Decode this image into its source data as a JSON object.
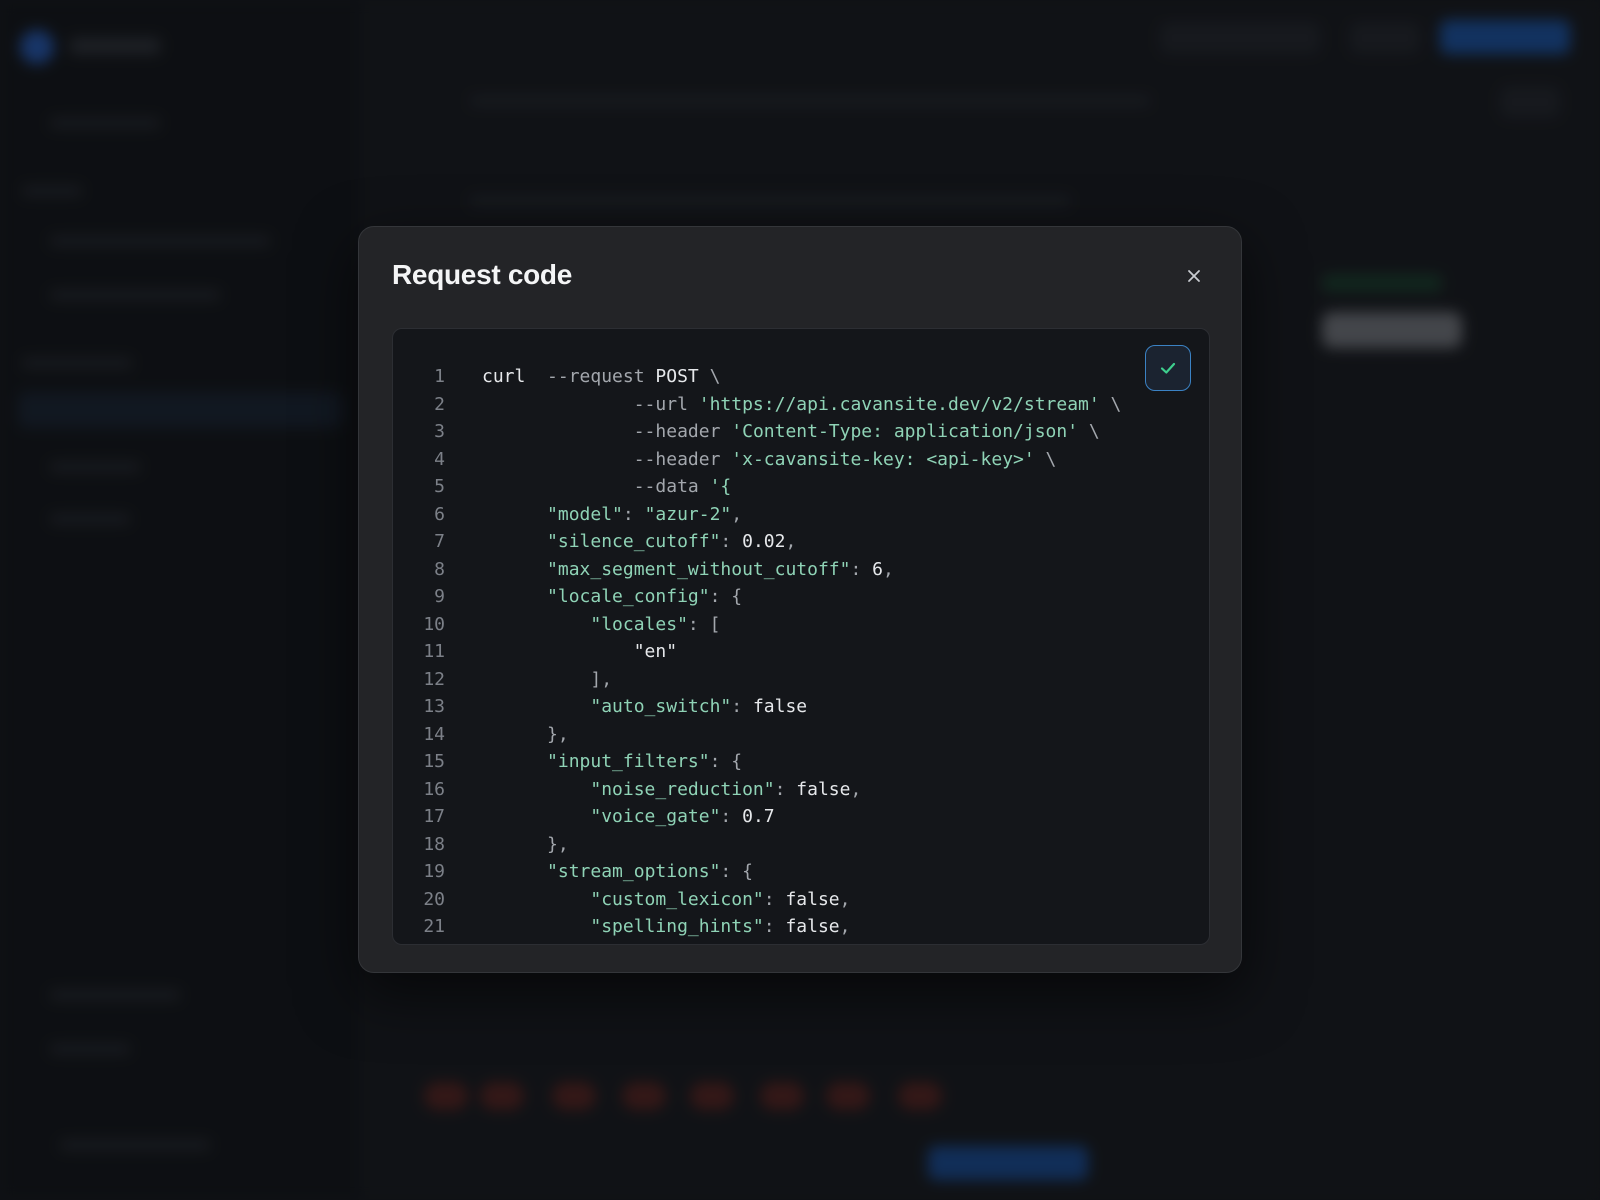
{
  "modal": {
    "title": "Request code",
    "close_icon": "close-icon",
    "copy_icon": "checkmark-icon",
    "colors": {
      "code_bg": "#14161a",
      "string": "#8fd3b6",
      "copy_border": "#3b82c4",
      "check": "#3ecf8e"
    }
  },
  "code": {
    "lines": [
      {
        "n": "1",
        "tokens": [
          {
            "t": "cmd",
            "v": "curl  "
          },
          {
            "t": "flag",
            "v": "--request "
          },
          {
            "t": "cmd",
            "v": "POST"
          },
          {
            "t": "punc",
            "v": " \\"
          }
        ]
      },
      {
        "n": "2",
        "tokens": [
          {
            "t": "punc",
            "v": "              "
          },
          {
            "t": "flag",
            "v": "--url "
          },
          {
            "t": "str",
            "v": "'https://api.cavansite.dev/v2/stream'"
          },
          {
            "t": "punc",
            "v": " \\"
          }
        ]
      },
      {
        "n": "3",
        "tokens": [
          {
            "t": "punc",
            "v": "              "
          },
          {
            "t": "flag",
            "v": "--header "
          },
          {
            "t": "str",
            "v": "'Content-Type: application/json'"
          },
          {
            "t": "punc",
            "v": " \\"
          }
        ]
      },
      {
        "n": "4",
        "tokens": [
          {
            "t": "punc",
            "v": "              "
          },
          {
            "t": "flag",
            "v": "--header "
          },
          {
            "t": "str",
            "v": "'x-cavansite-key: <api-key>'"
          },
          {
            "t": "punc",
            "v": " \\"
          }
        ]
      },
      {
        "n": "5",
        "tokens": [
          {
            "t": "punc",
            "v": "              "
          },
          {
            "t": "flag",
            "v": "--data "
          },
          {
            "t": "str",
            "v": "'{"
          }
        ]
      },
      {
        "n": "6",
        "tokens": [
          {
            "t": "punc",
            "v": "      "
          },
          {
            "t": "key",
            "v": "\"model\""
          },
          {
            "t": "punc",
            "v": ": "
          },
          {
            "t": "str",
            "v": "\"azur-2\""
          },
          {
            "t": "punc",
            "v": ","
          }
        ]
      },
      {
        "n": "7",
        "tokens": [
          {
            "t": "punc",
            "v": "      "
          },
          {
            "t": "key",
            "v": "\"silence_cutoff\""
          },
          {
            "t": "punc",
            "v": ": "
          },
          {
            "t": "val",
            "v": "0.02"
          },
          {
            "t": "punc",
            "v": ","
          }
        ]
      },
      {
        "n": "8",
        "tokens": [
          {
            "t": "punc",
            "v": "      "
          },
          {
            "t": "key",
            "v": "\"max_segment_without_cutoff\""
          },
          {
            "t": "punc",
            "v": ": "
          },
          {
            "t": "val",
            "v": "6"
          },
          {
            "t": "punc",
            "v": ","
          }
        ]
      },
      {
        "n": "9",
        "tokens": [
          {
            "t": "punc",
            "v": "      "
          },
          {
            "t": "key",
            "v": "\"locale_config\""
          },
          {
            "t": "punc",
            "v": ": {"
          }
        ]
      },
      {
        "n": "10",
        "tokens": [
          {
            "t": "punc",
            "v": "          "
          },
          {
            "t": "key",
            "v": "\"locales\""
          },
          {
            "t": "punc",
            "v": ": ["
          }
        ]
      },
      {
        "n": "11",
        "tokens": [
          {
            "t": "punc",
            "v": "              "
          },
          {
            "t": "val",
            "v": "\"en\""
          }
        ]
      },
      {
        "n": "12",
        "tokens": [
          {
            "t": "punc",
            "v": "          ],"
          }
        ]
      },
      {
        "n": "13",
        "tokens": [
          {
            "t": "punc",
            "v": "          "
          },
          {
            "t": "key",
            "v": "\"auto_switch\""
          },
          {
            "t": "punc",
            "v": ": "
          },
          {
            "t": "val",
            "v": "false"
          }
        ]
      },
      {
        "n": "14",
        "tokens": [
          {
            "t": "punc",
            "v": "      },"
          }
        ]
      },
      {
        "n": "15",
        "tokens": [
          {
            "t": "punc",
            "v": "      "
          },
          {
            "t": "key",
            "v": "\"input_filters\""
          },
          {
            "t": "punc",
            "v": ": {"
          }
        ]
      },
      {
        "n": "16",
        "tokens": [
          {
            "t": "punc",
            "v": "          "
          },
          {
            "t": "key",
            "v": "\"noise_reduction\""
          },
          {
            "t": "punc",
            "v": ": "
          },
          {
            "t": "val",
            "v": "false"
          },
          {
            "t": "punc",
            "v": ","
          }
        ]
      },
      {
        "n": "17",
        "tokens": [
          {
            "t": "punc",
            "v": "          "
          },
          {
            "t": "key",
            "v": "\"voice_gate\""
          },
          {
            "t": "punc",
            "v": ": "
          },
          {
            "t": "val",
            "v": "0.7"
          }
        ]
      },
      {
        "n": "18",
        "tokens": [
          {
            "t": "punc",
            "v": "      },"
          }
        ]
      },
      {
        "n": "19",
        "tokens": [
          {
            "t": "punc",
            "v": "      "
          },
          {
            "t": "key",
            "v": "\"stream_options\""
          },
          {
            "t": "punc",
            "v": ": {"
          }
        ]
      },
      {
        "n": "20",
        "tokens": [
          {
            "t": "punc",
            "v": "          "
          },
          {
            "t": "key",
            "v": "\"custom_lexicon\""
          },
          {
            "t": "punc",
            "v": ": "
          },
          {
            "t": "val",
            "v": "false"
          },
          {
            "t": "punc",
            "v": ","
          }
        ]
      },
      {
        "n": "21",
        "tokens": [
          {
            "t": "punc",
            "v": "          "
          },
          {
            "t": "key",
            "v": "\"spelling_hints\""
          },
          {
            "t": "punc",
            "v": ": "
          },
          {
            "t": "val",
            "v": "false"
          },
          {
            "t": "punc",
            "v": ","
          }
        ]
      }
    ]
  }
}
